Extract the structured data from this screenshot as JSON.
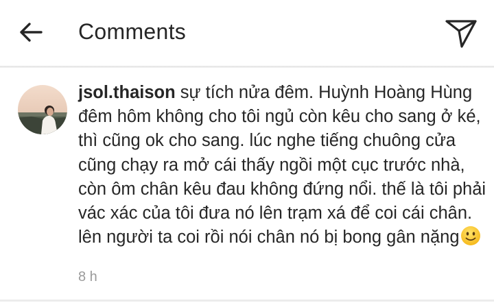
{
  "header": {
    "title": "Comments",
    "back_icon": "arrow-left-icon",
    "share_icon": "paper-plane-icon"
  },
  "comment": {
    "username": "jsol.thaison",
    "text": "sự tích nửa đêm. Huỳnh Hoàng Hùng đêm hôm không cho tôi ngủ còn kêu cho sang ở ké, thì cũng ok cho sang. lúc nghe tiếng chuông cửa cũng chạy ra mở cái thấy ngồi một cục trước nhà, còn ôm chân kêu đau không đứng nổi. thế là tôi phải vác xác của tôi đưa nó lên trạm xá để coi cái chân. lên người ta coi rồi nói chân nó bị bong gân nặng",
    "emoji_icon": "slightly-smiling-face-icon",
    "time": "8 h"
  },
  "colors": {
    "text": "#262626",
    "secondary_text": "#9a9a9a",
    "divider": "#e6e6e6"
  }
}
